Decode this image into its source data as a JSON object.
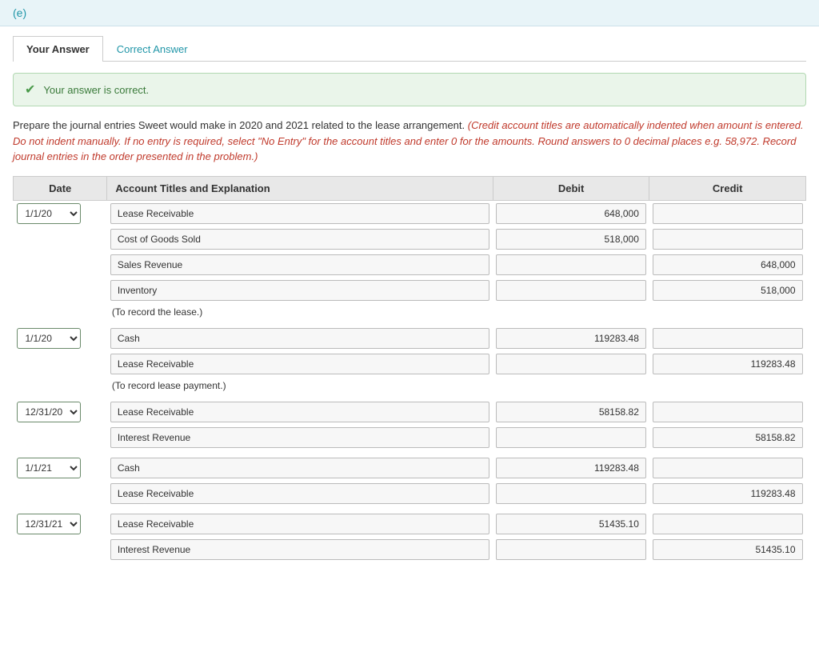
{
  "topBar": {
    "label": "(e)"
  },
  "tabs": [
    {
      "id": "your-answer",
      "label": "Your Answer",
      "active": true
    },
    {
      "id": "correct-answer",
      "label": "Correct Answer",
      "active": false
    }
  ],
  "successBanner": {
    "icon": "✔",
    "text": "Your answer is correct."
  },
  "instructions": {
    "normal": "Prepare the journal entries Sweet would make in 2020 and 2021 related to the lease arrangement.",
    "italic": "(Credit account titles are automatically indented when amount is entered. Do not indent manually. If no entry is required, select \"No Entry\" for the account titles and enter 0 for the amounts. Round answers to 0 decimal places e.g. 58,972. Record journal entries in the order presented in the problem.)"
  },
  "tableHeaders": {
    "date": "Date",
    "account": "Account Titles and Explanation",
    "debit": "Debit",
    "credit": "Credit"
  },
  "journalGroups": [
    {
      "id": "group1",
      "dateValue": "1/1/20",
      "rows": [
        {
          "account": "Lease Receivable",
          "debit": "648,000",
          "credit": ""
        },
        {
          "account": "Cost of Goods Sold",
          "debit": "518,000",
          "credit": ""
        },
        {
          "account": "Sales Revenue",
          "debit": "",
          "credit": "648,000"
        },
        {
          "account": "Inventory",
          "debit": "",
          "credit": "518,000"
        }
      ],
      "note": "(To record the lease.)"
    },
    {
      "id": "group2",
      "dateValue": "1/1/20",
      "rows": [
        {
          "account": "Cash",
          "debit": "119283.48",
          "credit": ""
        },
        {
          "account": "Lease Receivable",
          "debit": "",
          "credit": "119283.48"
        }
      ],
      "note": "(To record lease payment.)"
    },
    {
      "id": "group3",
      "dateValue": "12/31/20",
      "rows": [
        {
          "account": "Lease Receivable",
          "debit": "58158.82",
          "credit": ""
        },
        {
          "account": "Interest Revenue",
          "debit": "",
          "credit": "58158.82"
        }
      ],
      "note": ""
    },
    {
      "id": "group4",
      "dateValue": "1/1/21",
      "rows": [
        {
          "account": "Cash",
          "debit": "119283.48",
          "credit": ""
        },
        {
          "account": "Lease Receivable",
          "debit": "",
          "credit": "119283.48"
        }
      ],
      "note": ""
    },
    {
      "id": "group5",
      "dateValue": "12/31/21",
      "rows": [
        {
          "account": "Lease Receivable",
          "debit": "51435.10",
          "credit": ""
        },
        {
          "account": "Interest Revenue",
          "debit": "",
          "credit": "51435.10"
        }
      ],
      "note": ""
    }
  ]
}
